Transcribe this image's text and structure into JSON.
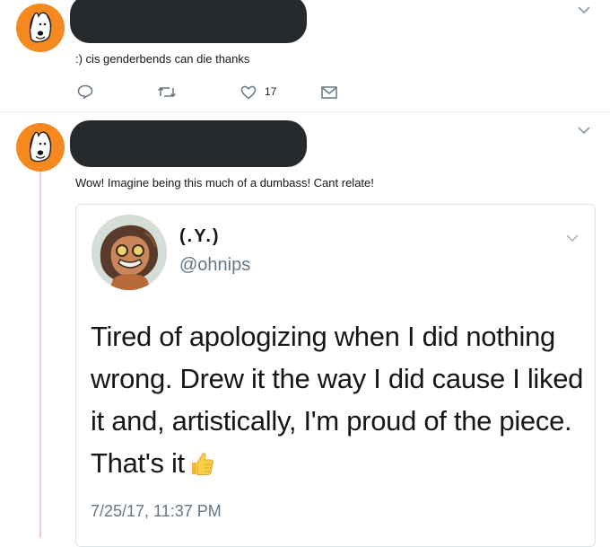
{
  "tweet1": {
    "text": ":) cis genderbends can die thanks",
    "like_count": "17"
  },
  "tweet2": {
    "text": "Wow! Imagine being this much of a dumbass! Cant relate!"
  },
  "quoted": {
    "name": "(.Y.)",
    "handle": "@ohnips",
    "body": "Tired of apologizing when I did nothing wrong. Drew it the way I did cause I liked it and, artistically, I'm proud of the piece. That's it",
    "emoji": "thumbs-up-icon",
    "timestamp": "7/25/17, 11:37 PM"
  },
  "colors": {
    "avatar_bg": "#f5891f",
    "redaction": "#272a2d",
    "thread_line": "#f3c9cf",
    "muted_text": "#657786"
  }
}
